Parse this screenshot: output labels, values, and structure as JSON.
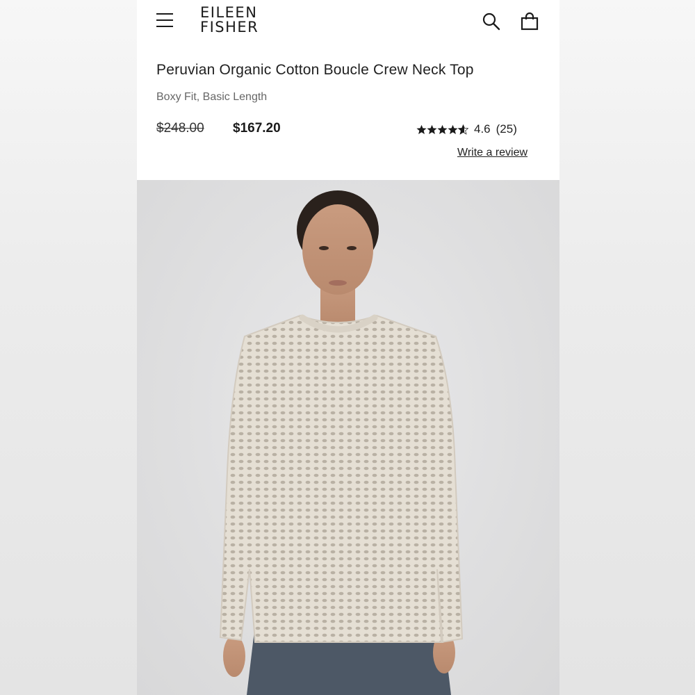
{
  "brand": {
    "line1": "EILEEN",
    "line2": "FISHER"
  },
  "header": {
    "menu_icon": "hamburger-menu-icon",
    "search_icon": "search-icon",
    "bag_icon": "shopping-bag-icon"
  },
  "product": {
    "title": "Peruvian Organic Cotton Boucle Crew Neck Top",
    "fit": "Boxy Fit, Basic Length",
    "price_original": "$248.00",
    "price_sale": "$167.20",
    "rating_value": "4.6",
    "rating_count": "(25)",
    "rating_stars": 4.6,
    "write_review_label": "Write a review"
  },
  "colors": {
    "sweater": "#e3ddd2",
    "skirt": "#4d5866",
    "backdrop": "#dedede",
    "text": "#1f1f1f"
  }
}
